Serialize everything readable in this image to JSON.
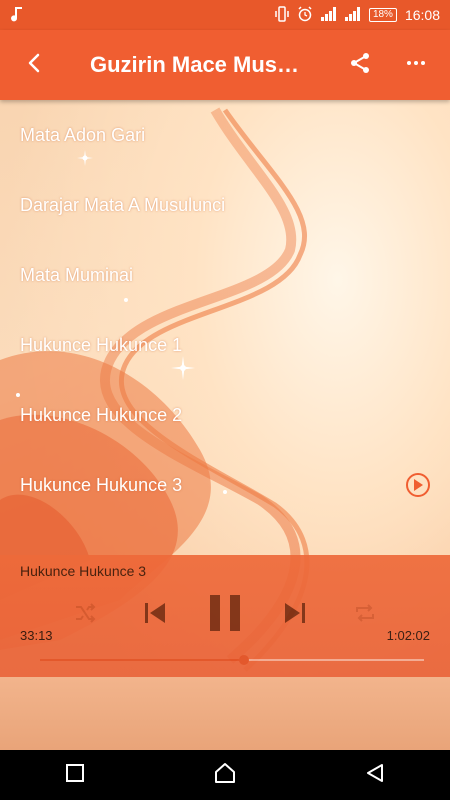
{
  "status_bar": {
    "time": "16:08",
    "battery": "18%"
  },
  "app_bar": {
    "title": "Guzirin Mace Mus…"
  },
  "tracks": [
    {
      "label": "Mata Adon Gari"
    },
    {
      "label": "Darajar Mata A Musulunci"
    },
    {
      "label": "Mata Muminai"
    },
    {
      "label": "Hukunce Hukunce 1"
    },
    {
      "label": "Hukunce Hukunce 2"
    },
    {
      "label": "Hukunce Hukunce 3"
    }
  ],
  "player": {
    "now_playing": "Hukunce Hukunce 3",
    "elapsed": "33:13",
    "duration": "1:02:02",
    "progress": 0.53
  },
  "colors": {
    "accent": "#f05e31",
    "status_bar": "#e8582a",
    "nav_bar": "#000000"
  },
  "icons": {
    "back": "arrow-left-icon",
    "share": "share-icon",
    "more": "more-vertical-icon",
    "shuffle": "shuffle-icon",
    "previous": "skip-previous-icon",
    "pause": "pause-icon",
    "next": "skip-next-icon",
    "repeat": "repeat-icon"
  }
}
